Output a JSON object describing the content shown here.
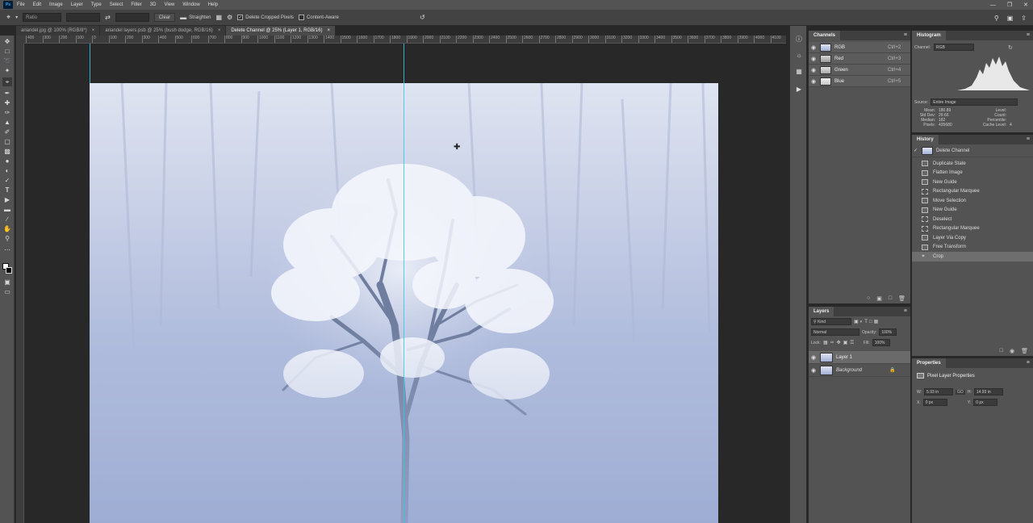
{
  "app": {
    "menu": [
      "File",
      "Edit",
      "Image",
      "Layer",
      "Type",
      "Select",
      "Filter",
      "3D",
      "View",
      "Window",
      "Help"
    ],
    "logo_text": "Ps"
  },
  "options": {
    "ratio_label": "Ratio",
    "clear_label": "Clear",
    "straighten_label": "Straighten",
    "delete_cropped_label": "Delete Cropped Pixels",
    "content_aware_label": "Content-Aware"
  },
  "tabs": [
    {
      "label": "ariandel.jpg @ 100% (RGB/8*)"
    },
    {
      "label": "ariandel layers.psb @ 25% (bush dodge, RGB/16)"
    },
    {
      "label": "Delete Channel @ 25% (Layer 1, RGB/16)"
    }
  ],
  "ruler": [
    "400",
    "300",
    "200",
    "100",
    "0",
    "100",
    "200",
    "300",
    "400",
    "500",
    "600",
    "700",
    "800",
    "900",
    "1000",
    "1100",
    "1200",
    "1300",
    "1400",
    "1500",
    "1600",
    "1700",
    "1800",
    "1900",
    "2000",
    "2100",
    "2200",
    "2300",
    "2400",
    "2500",
    "2600",
    "2700",
    "2800",
    "2900",
    "3000",
    "3100",
    "3200",
    "3300",
    "3400",
    "3500",
    "3600",
    "3700",
    "3800",
    "3900",
    "4000",
    "4100"
  ],
  "channels": {
    "title": "Channels",
    "items": [
      {
        "name": "RGB",
        "shortcut": "Ctrl+2"
      },
      {
        "name": "Red",
        "shortcut": "Ctrl+3"
      },
      {
        "name": "Green",
        "shortcut": "Ctrl+4"
      },
      {
        "name": "Blue",
        "shortcut": "Ctrl+5"
      }
    ]
  },
  "histogram": {
    "title": "Histogram",
    "channel_label": "Channel:",
    "channel_value": "RGB",
    "source_label": "Source:",
    "source_value": "Entire Image",
    "stats": {
      "mean_label": "Mean:",
      "mean": "180.89",
      "std_label": "Std Dev:",
      "std": "29.66",
      "median_label": "Median:",
      "median": "182",
      "pixels_label": "Pixels:",
      "pixels": "435680",
      "level_label": "Level:",
      "count_label": "Count:",
      "percentile_label": "Percentile:",
      "cache_label": "Cache Level:",
      "cache": "4"
    }
  },
  "history": {
    "title": "History",
    "snapshot": "Delete Channel",
    "items": [
      "Duplicate State",
      "Flatten Image",
      "New Guide",
      "Rectangular Marquee",
      "Move Selection",
      "New Guide",
      "Deselect",
      "Rectangular Marquee",
      "Layer Via Copy",
      "Free Transform",
      "Crop"
    ]
  },
  "layers": {
    "title": "Layers",
    "kind": "Kind",
    "blend": "Normal",
    "opacity_label": "Opacity:",
    "opacity": "100%",
    "lock_label": "Lock:",
    "fill_label": "Fill:",
    "fill": "100%",
    "items": [
      {
        "name": "Layer 1"
      },
      {
        "name": "Background"
      }
    ]
  },
  "properties": {
    "title": "Properties",
    "heading": "Pixel Layer Properties",
    "w_label": "W:",
    "w": "5.93 in",
    "h_label": "H:",
    "h": "14.93 in",
    "link_label": "GO",
    "x_label": "X:",
    "x": "0 px",
    "y_label": "Y:",
    "y": "0 px"
  }
}
